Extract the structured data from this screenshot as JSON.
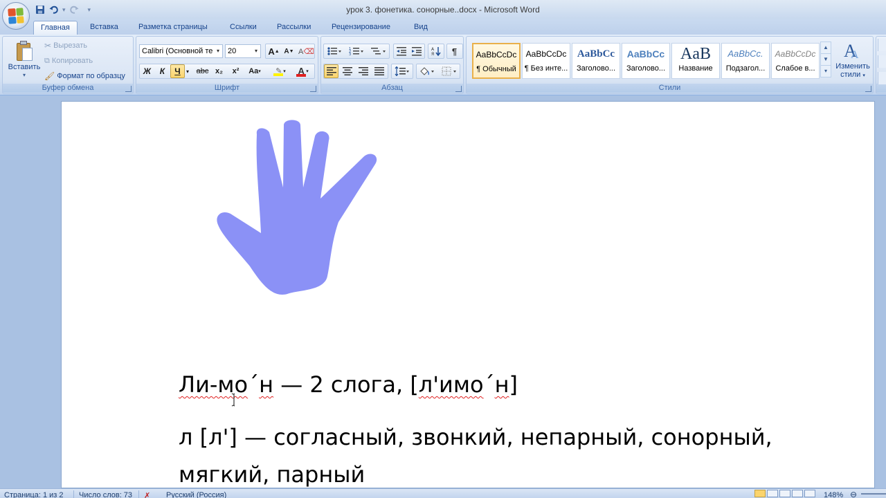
{
  "window": {
    "title": "урок 3. фонетика. сонорные..docx - Microsoft Word"
  },
  "tabs": [
    {
      "label": "Главная",
      "active": true
    },
    {
      "label": "Вставка"
    },
    {
      "label": "Разметка страницы"
    },
    {
      "label": "Ссылки"
    },
    {
      "label": "Рассылки"
    },
    {
      "label": "Рецензирование"
    },
    {
      "label": "Вид"
    }
  ],
  "ribbon": {
    "clipboard": {
      "paste": "Вставить",
      "cut": "Вырезать",
      "copy": "Копировать",
      "format_painter": "Формат по образцу",
      "label": "Буфер обмена"
    },
    "font": {
      "name": "Calibri (Основной те",
      "size": "20",
      "bold": "Ж",
      "italic": "К",
      "underline": "Ч",
      "strike": "abc",
      "subscript": "x₂",
      "superscript": "x²",
      "change_case": "Aa",
      "grow": "A",
      "shrink": "A",
      "font_color": "A",
      "label": "Шрифт"
    },
    "paragraph": {
      "pilcrow": "¶",
      "label": "Абзац"
    },
    "styles": {
      "items": [
        {
          "sample": "AaBbCcDc",
          "name": "¶ Обычный",
          "selected": true
        },
        {
          "sample": "AaBbCcDc",
          "name": "¶ Без инте..."
        },
        {
          "sample": "AaBbCc",
          "name": "Заголово..."
        },
        {
          "sample": "AaBbCc",
          "name": "Заголово..."
        },
        {
          "sample": "AaB",
          "name": "Название"
        },
        {
          "sample": "AaBbCc.",
          "name": "Подзагол..."
        },
        {
          "sample": "AaBbCcDc",
          "name": "Слабое в..."
        }
      ],
      "change_styles_1": "Изменить",
      "change_styles_2": "стили",
      "label": "Стили"
    }
  },
  "document": {
    "hand_color": "#8b91f6",
    "line1": {
      "w1": "Ли-мо",
      "w2": "н",
      "rest": " — 2 слога, [",
      "t1": "л'имо",
      "t2": "н",
      "close": "]"
    },
    "line2": "л [л'] — согласный, звонкий, непарный, сонорный,",
    "line3": "мягкий, парный"
  },
  "status": {
    "page": "Страница: 1 из 2",
    "words": "Число слов: 73",
    "language": "Русский (Россия)",
    "zoom": "148%"
  }
}
